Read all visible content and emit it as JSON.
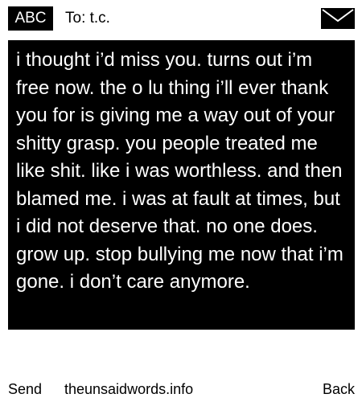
{
  "header": {
    "mode_label": "ABC",
    "to_label": "To: t.c.",
    "envelope_icon": "envelope-icon"
  },
  "message": {
    "text": "i thought i’d miss you. turns out i’m free now. the o lu thing i’ll ever thank you for is giving me a way out of your shitty grasp. you people treated me like shit. like i was worthless. and then blamed me. i was at fault at times, but i did not deserve that. no one does. grow up. stop bullying me now that i’m gone. i don’t care anymore."
  },
  "footer": {
    "send_label": "Send",
    "site_label": "theunsaidwords.info",
    "back_label": "Back"
  },
  "colors": {
    "background": "#ffffff",
    "message_background": "#000000",
    "message_text": "#ffffff",
    "accent": "#000000"
  }
}
